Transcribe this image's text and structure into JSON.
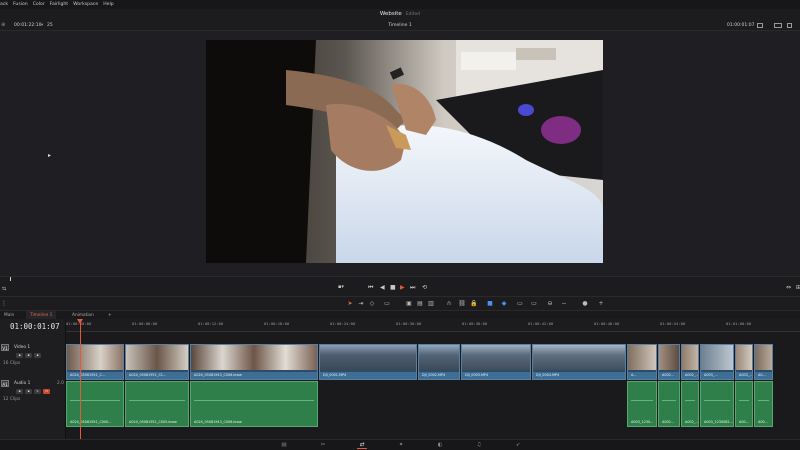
{
  "menu": [
    "ack",
    "Fusion",
    "Color",
    "Fairlight",
    "Workspace",
    "Help"
  ],
  "project": {
    "title": "Website",
    "status": "Edited"
  },
  "viewer_header": {
    "left_timecode": "00:01:22:10",
    "left_extra": "25",
    "timeline_name": "Timeline 1",
    "right_timecode": "01:00:01:07"
  },
  "timeline_tabs": [
    "Main",
    "Timeline 1",
    "Animation",
    "+"
  ],
  "timecode": "01:00:01:07",
  "ruler_ticks": [
    "01:00:00:00",
    "01:00:06:00",
    "01:00:12:00",
    "01:00:18:00",
    "01:00:24:00",
    "01:00:30:00",
    "01:00:36:00",
    "01:00:42:00",
    "01:00:48:00",
    "01:00:54:00",
    "01:01:00:00"
  ],
  "tracks": {
    "video": {
      "id": "V1",
      "name": "Video 1",
      "clips_count": "16 Clips"
    },
    "audio": {
      "id": "A1",
      "name": "Audio 1",
      "level": "2.0",
      "clips_count": "12 Clips"
    }
  },
  "video_clips": [
    {
      "name": "A024_05081951_C..."
    },
    {
      "name": "A024_05081951_C1..."
    },
    {
      "name": "A024_05081943_C006.braw"
    },
    {
      "name": ""
    },
    {
      "name": "DJI_0001.MP4"
    },
    {
      "name": "DJI_0002.MP4"
    },
    {
      "name": "DJI_0003.MP4"
    },
    {
      "name": "DJI_0004.MP4"
    },
    {
      "name": "A..."
    },
    {
      "name": "A002..."
    },
    {
      "name": "A002_..."
    },
    {
      "name": "A003_..."
    },
    {
      "name": "A003_..."
    },
    {
      "name": "A0..."
    }
  ],
  "audio_clips": [
    {
      "name": "A024_05081951_C000..."
    },
    {
      "name": "A024_05081951_C005.braw"
    },
    {
      "name": "A024_05081943_C006.braw"
    },
    {
      "name": "A003_1230..."
    },
    {
      "name": "A002..."
    },
    {
      "name": "A002_..."
    },
    {
      "name": "A003_1230082..."
    },
    {
      "name": "A00..."
    },
    {
      "name": "A00..."
    }
  ],
  "colors": {
    "accent": "#e35a38",
    "video_clip": "#3d6e96",
    "audio_clip": "#2f7f4b"
  }
}
